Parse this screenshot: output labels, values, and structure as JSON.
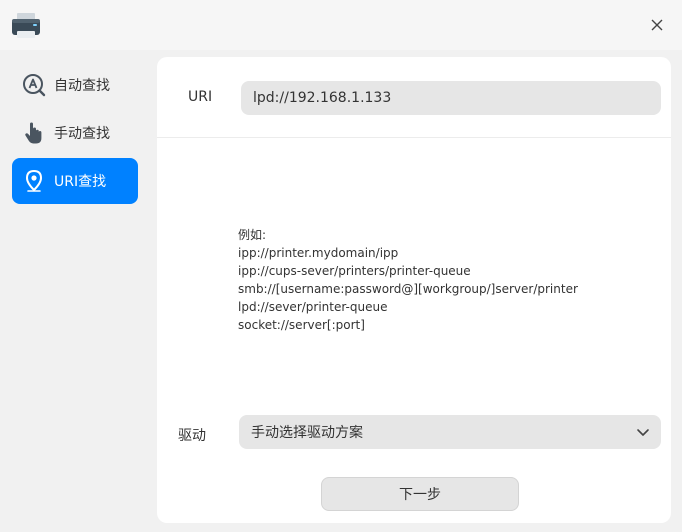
{
  "window": {
    "app_icon": "printer-icon",
    "close_icon": "close-icon"
  },
  "sidebar": {
    "items": [
      {
        "label": "自动查找",
        "icon": "auto-search-icon"
      },
      {
        "label": "手动查找",
        "icon": "hand-pointer-icon"
      },
      {
        "label": "URI查找",
        "icon": "location-pin-icon",
        "active": true
      }
    ]
  },
  "uri": {
    "label": "URI",
    "value": "lpd://192.168.1.133"
  },
  "examples": {
    "heading": "例如:",
    "lines": [
      "ipp://printer.mydomain/ipp",
      "ipp://cups-sever/printers/printer-queue",
      "smb://[username:password@][workgroup/]server/printer",
      "lpd://sever/printer-queue",
      "socket://server[:port]"
    ]
  },
  "driver": {
    "label": "驱动",
    "selected": "手动选择驱动方案"
  },
  "next_button": "下一步",
  "colors": {
    "accent": "#0081ff",
    "panel": "#ffffff",
    "background": "#f1f1f1",
    "input": "#e6e6e6"
  }
}
